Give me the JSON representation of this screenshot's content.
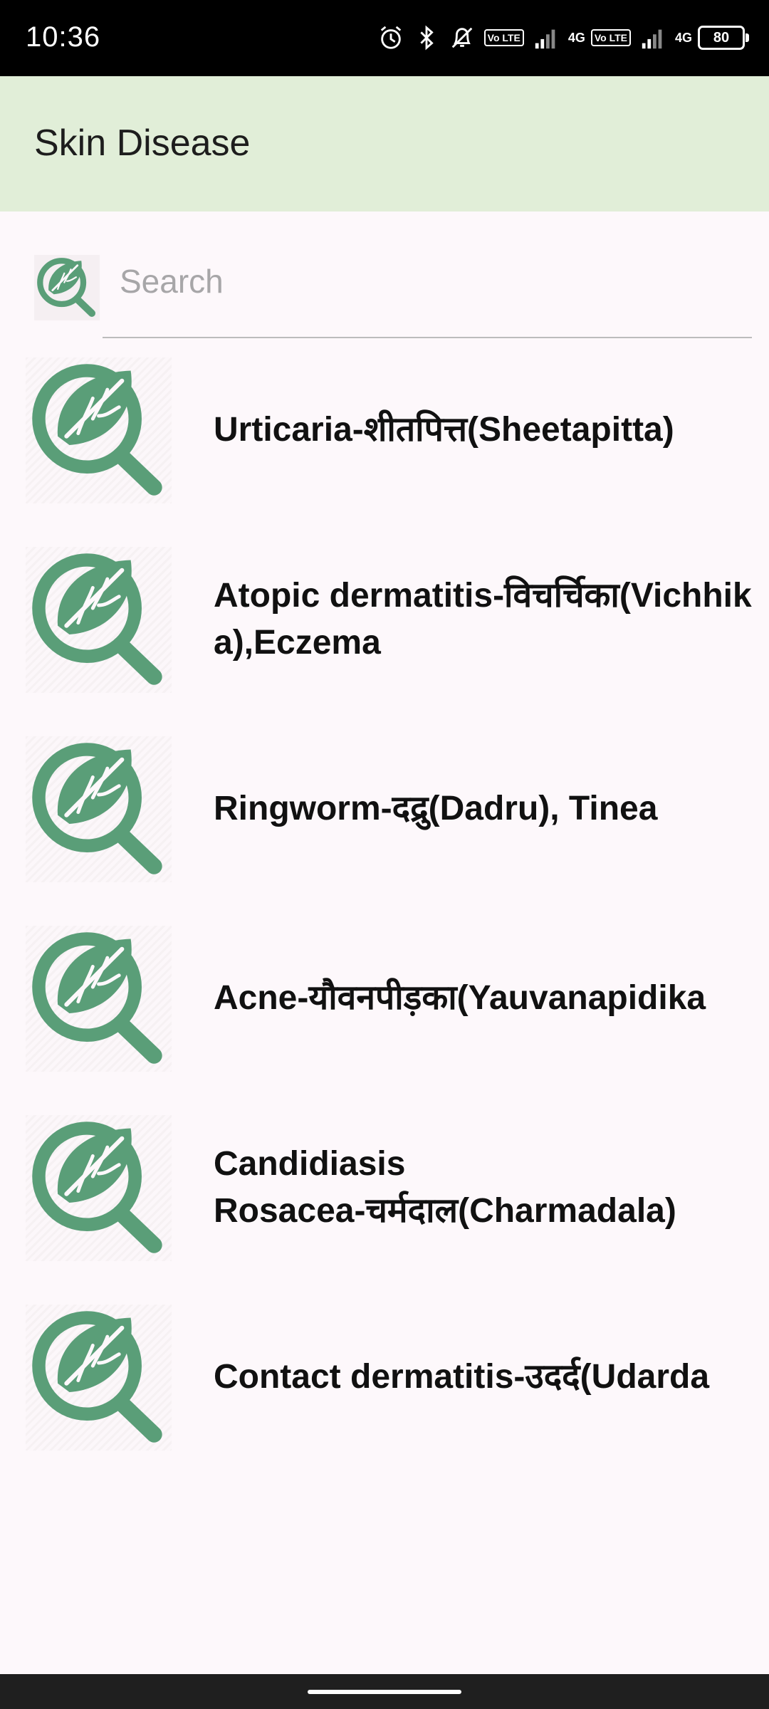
{
  "status_bar": {
    "time": "10:36",
    "battery": "80",
    "network_label_1": "4G",
    "network_label_2": "4G",
    "volte_badge": "Vo LTE",
    "icons": [
      "alarm-icon",
      "bluetooth-icon",
      "bell-muted-icon",
      "volte-icon",
      "signal-icon",
      "signal-icon",
      "battery-icon"
    ]
  },
  "app_bar": {
    "title": "Skin Disease"
  },
  "search": {
    "placeholder": "Search",
    "value": ""
  },
  "colors": {
    "accent_green": "#5a9e78",
    "app_bar_bg": "#e1eed8"
  },
  "diseases": [
    {
      "label": "Urticaria-शीतपित्त(Sheetapitta)",
      "icon": "leaf-magnifier-icon"
    },
    {
      "label": "Atopic dermatitis-विचर्चिका(Vichhika),Eczema",
      "icon": "leaf-magnifier-icon"
    },
    {
      "label": "Ringworm-दद्रु(Dadru), Tinea",
      "icon": "leaf-magnifier-icon"
    },
    {
      "label": "Acne-यौवनपीड़का(Yauvanapidika",
      "icon": "leaf-magnifier-icon"
    },
    {
      "label": "Candidiasis\nRosacea-चर्मदाल(Charmadala)",
      "icon": "leaf-magnifier-icon"
    },
    {
      "label": "Contact dermatitis-उदर्द(Udarda",
      "icon": "leaf-magnifier-icon"
    }
  ]
}
